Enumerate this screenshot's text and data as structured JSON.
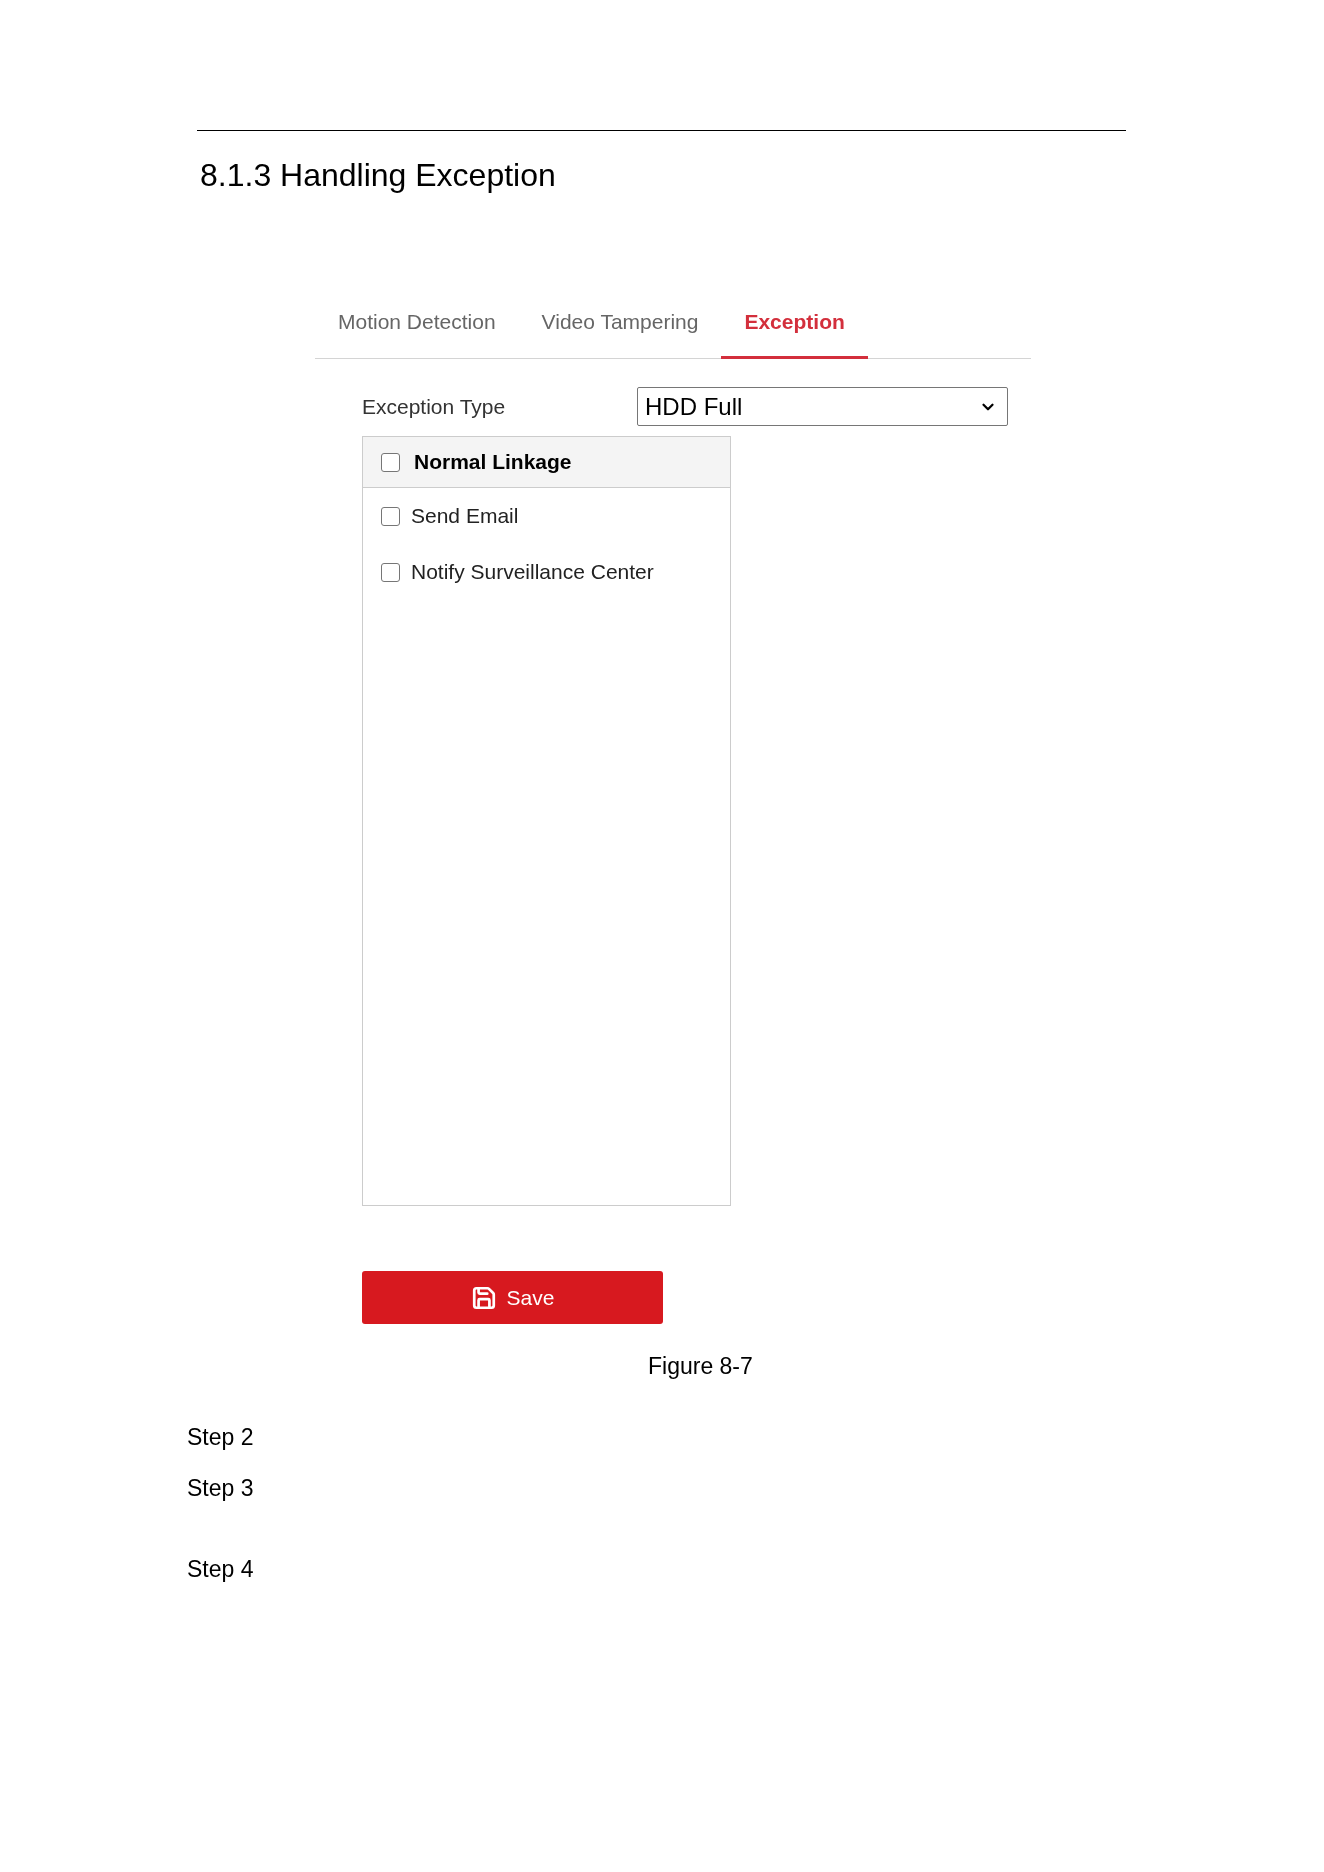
{
  "document": {
    "section_heading": "8.1.3 Handling Exception"
  },
  "tabs": [
    {
      "label": "Motion Detection",
      "selected": false
    },
    {
      "label": "Video Tampering",
      "selected": false
    },
    {
      "label": "Exception",
      "selected": true
    }
  ],
  "exception_type": {
    "label": "Exception Type",
    "value": "HDD Full"
  },
  "linkage": {
    "header": {
      "label": "Normal Linkage",
      "checked": false
    },
    "items": [
      {
        "label": "Send Email",
        "checked": false
      },
      {
        "label": "Notify Surveillance Center",
        "checked": false
      }
    ]
  },
  "save_button": {
    "label": "Save"
  },
  "figure_caption": "Figure 8-7",
  "steps": [
    "Step 2",
    "Step 3",
    "Step 4"
  ]
}
